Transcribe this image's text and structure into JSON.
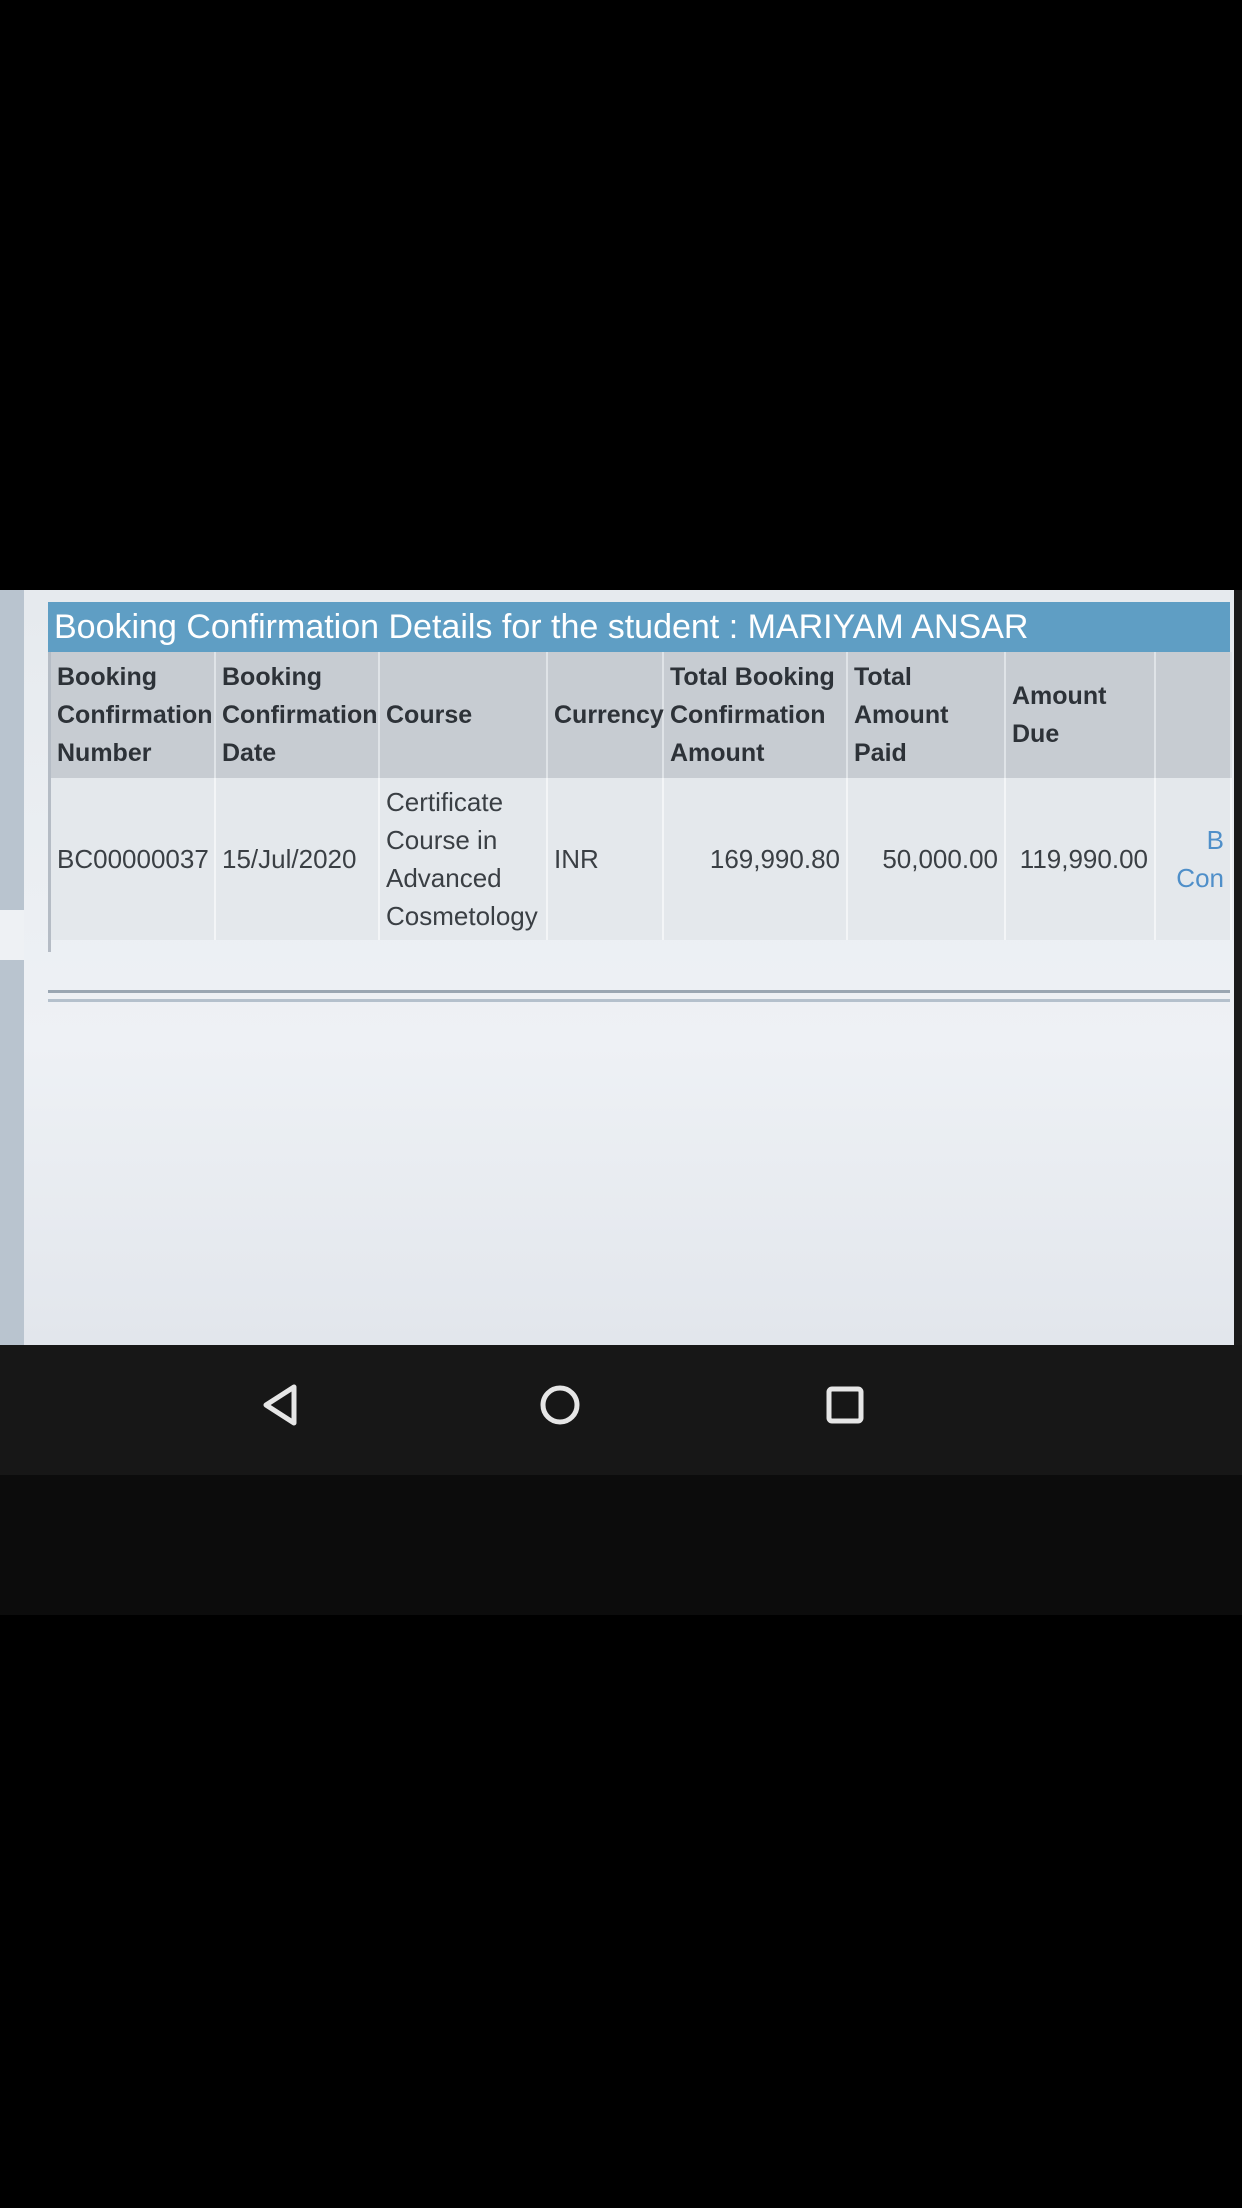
{
  "title": "Booking Confirmation Details for the student : MARIYAM ANSAR",
  "table": {
    "headers": [
      "Booking Confirmation Number",
      "Booking Confirmation Date",
      "Course",
      "Currency",
      "Total Booking Confirmation Amount",
      "Total Amount Paid",
      "Amount Due"
    ],
    "rows": [
      {
        "number": "BC00000037",
        "date": "15/Jul/2020",
        "course": "Certificate Course in Advanced Cosmetology",
        "currency": "INR",
        "total_amount": "169,990.80",
        "amount_paid": "50,000.00",
        "amount_due": "119,990.00",
        "action_partial_line1": "B",
        "action_partial_line2": "Con"
      }
    ]
  },
  "nav": {
    "back": "back-icon",
    "home": "home-icon",
    "recents": "recents-icon"
  },
  "colors": {
    "title_bar": "#5f9ec4",
    "header_bg": "#c7ccd2",
    "link": "#4f8fc9"
  }
}
